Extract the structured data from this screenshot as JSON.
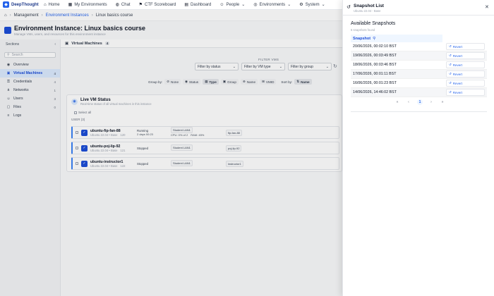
{
  "topnav": {
    "brand": "DeepThought",
    "items": [
      {
        "label": "Home",
        "icon": "home-icon",
        "glyph": "⌂"
      },
      {
        "label": "My Environments",
        "icon": "layers-icon",
        "glyph": "▦"
      },
      {
        "label": "Chat",
        "icon": "chat-icon",
        "glyph": "◍"
      },
      {
        "label": "CTF Scoreboard",
        "icon": "flag-icon",
        "glyph": "⚑"
      },
      {
        "label": "Dashboard",
        "icon": "dashboard-icon",
        "glyph": "▤"
      },
      {
        "label": "People",
        "icon": "people-icon",
        "glyph": "☺",
        "dropdown": true
      },
      {
        "label": "Environments",
        "icon": "globe-icon",
        "glyph": "◎",
        "dropdown": true
      },
      {
        "label": "System",
        "icon": "gear-icon",
        "glyph": "⚙",
        "dropdown": true
      }
    ]
  },
  "breadcrumb": [
    "Management",
    "Environment Instances",
    "Linux basics course"
  ],
  "header": {
    "title": "Environment Instance: Linux basics course",
    "subtitle": "Manage VMs, users, and resources for this environment instance"
  },
  "sidebar": {
    "title": "Sections",
    "search_placeholder": "Search",
    "items": [
      {
        "label": "Overview",
        "glyph": "◉",
        "count": ""
      },
      {
        "label": "Virtual Machines",
        "glyph": "▣",
        "count": "4",
        "active": true
      },
      {
        "label": "Credentials",
        "glyph": "⚿",
        "count": "4"
      },
      {
        "label": "Networks",
        "glyph": "⋔",
        "count": "1"
      },
      {
        "label": "Users",
        "glyph": "☺",
        "count": "3"
      },
      {
        "label": "Files",
        "glyph": "▢",
        "count": "0"
      },
      {
        "label": "Logs",
        "glyph": "≡",
        "count": ""
      }
    ]
  },
  "main": {
    "tab_label": "Virtual Machines",
    "tab_count": "4",
    "filter_title": "FILTER VMS",
    "filters": [
      "Filter by status",
      "Filter by VM type",
      "Filter by group"
    ],
    "group_by_label": "Group by:",
    "group_options": [
      "None",
      "Status",
      "Type",
      "Group",
      "Name",
      "VMID"
    ],
    "sort_by_label": "Sort by:",
    "sort_value": "Name"
  },
  "vm_panel": {
    "title": "Live VM Status",
    "subtitle": "Real-time status of all virtual machines in this instance",
    "select_all": "Select all",
    "group_label": "USER (3)",
    "rows": [
      {
        "name": "ubuntu-fip-fan-88",
        "os": "Ubuntu 22.04 • Base",
        "vmid": "120",
        "status": "Running",
        "uptime": "2 days 00:23",
        "pill": "Student LAN1",
        "cpu": "CPU: 0% of 2",
        "mem": "RAM: 45%",
        "tag": "fip-fan-88"
      },
      {
        "name": "ubuntu-poj-lip-92",
        "os": "Ubuntu 22.04 • Base",
        "vmid": "121",
        "status": "Stopped",
        "pill": "Student LAN1",
        "tag": "poj-lip-92"
      },
      {
        "name": "ubuntu-instructor1",
        "os": "Ubuntu 22.04 • Base",
        "vmid": "122",
        "status": "Stopped",
        "pill": "Student LAN1",
        "tag": "instructor1"
      }
    ]
  },
  "drawer": {
    "title": "Snapshot List",
    "subtitle": "Ubuntu 22.04 - Base",
    "available_title": "Available Snapshots",
    "count_text": "6 snapshots found",
    "column_header": "Snapshot",
    "revert_label": "Revert",
    "snapshots": [
      "20/06/2026, 00:02:10 BST",
      "19/06/2026, 00:03:49 BST",
      "18/06/2026, 00:03:46 BST",
      "17/06/2026, 00:01:11 BST",
      "16/06/2026, 00:01:23 BST",
      "14/06/2026, 14:46:02 BST"
    ],
    "pager": {
      "first": "«",
      "prev": "‹",
      "current": "1",
      "next": "›",
      "last": "»"
    }
  }
}
